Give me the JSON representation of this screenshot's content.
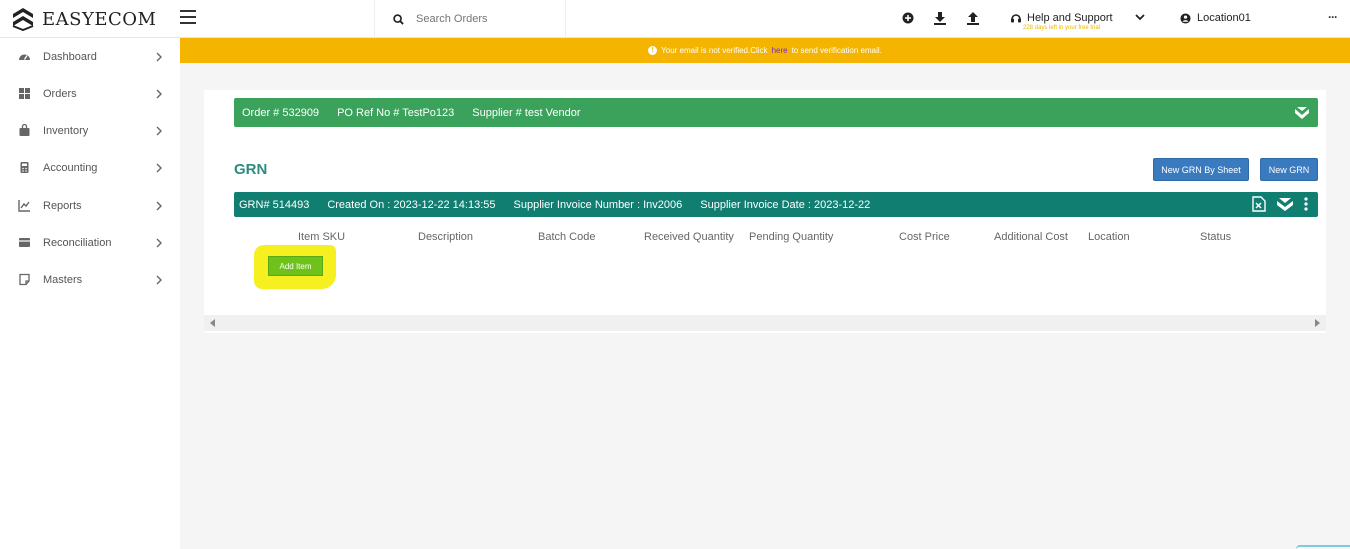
{
  "app": {
    "logo_text": "EASYECOM"
  },
  "search": {
    "placeholder": "Search Orders"
  },
  "header": {
    "help_title": "Help and Support",
    "trial_text": "228 days left in your free trial",
    "location": "Location01",
    "more": "···"
  },
  "sidebar": {
    "items": [
      {
        "label": "Dashboard",
        "icon": "dashboard-icon"
      },
      {
        "label": "Orders",
        "icon": "orders-icon"
      },
      {
        "label": "Inventory",
        "icon": "inventory-icon"
      },
      {
        "label": "Accounting",
        "icon": "accounting-icon"
      },
      {
        "label": "Reports",
        "icon": "reports-icon"
      },
      {
        "label": "Reconciliation",
        "icon": "reconciliation-icon"
      },
      {
        "label": "Masters",
        "icon": "masters-icon"
      }
    ]
  },
  "banner": {
    "text_before": "Your email is not verified.Click",
    "link": "here",
    "text_after": "to send verification email."
  },
  "order": {
    "order_no": "Order # 532909",
    "po_ref": "PO Ref No # TestPo123",
    "supplier": "Supplier # test Vendor"
  },
  "grn": {
    "title": "GRN",
    "new_by_sheet": "New GRN By Sheet",
    "new_grn": "New GRN",
    "grn_no": "GRN# 514493",
    "created_on": "Created On : 2023-12-22 14:13:55",
    "invoice_no": "Supplier Invoice Number : Inv2006",
    "invoice_date": "Supplier Invoice Date : 2023-12-22",
    "columns": [
      "Item SKU",
      "Description",
      "Batch Code",
      "Received Quantity",
      "Pending Quantity",
      "Cost Price",
      "Additional Cost",
      "Location",
      "Status"
    ],
    "add_item": "Add Item"
  },
  "colors": {
    "banner": "#f4b400",
    "order_bar": "#3aa25b",
    "grn_bar": "#117e72",
    "button_blue": "#3a7bbf",
    "add_item_green": "#6fc21a",
    "highlight_yellow": "#f7f020"
  }
}
